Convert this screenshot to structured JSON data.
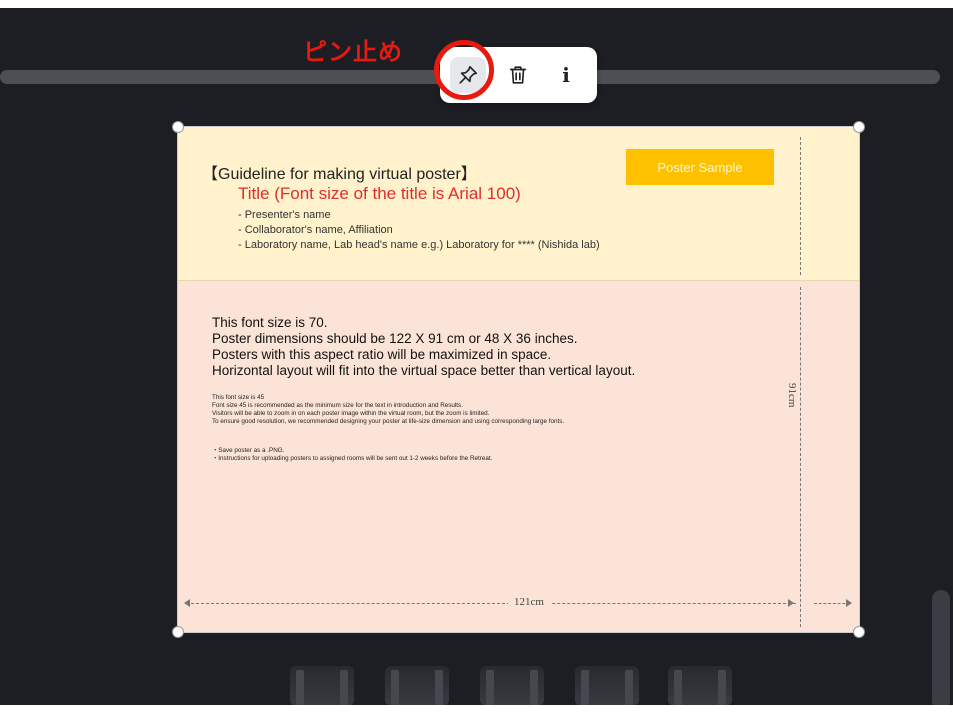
{
  "annotation": {
    "label": "ピン止め",
    "color": "#e8190f"
  },
  "toolbar": {
    "pin_icon": "pin-icon",
    "delete_icon": "trash-icon",
    "info_label": "i"
  },
  "poster": {
    "guideline_title": "【Guideline for making virtual poster】",
    "title_line": "Title (Font size of the title is Arial 100)",
    "header_lines": [
      "- Presenter's name",
      "- Collaborator's name, Affiliation",
      "- Laboratory name, Lab head's name     e.g.) Laboratory for **** (Nishida lab)"
    ],
    "sample_badge": "Poster Sample",
    "body_main": [
      "This font size is 70.",
      "Poster dimensions should be 122 X 91 cm or 48 X 36 inches.",
      "Posters with this aspect ratio will be maximized in space.",
      "Horizontal layout will fit into the virtual space better than vertical layout."
    ],
    "body_small": [
      "This font size is 45",
      "Font size 45 is recommended as the minimum size for the text in introduction and Results.",
      "Visitors will be able to zoom in on each poster image within the virtual room, but the zoom is limited.",
      "To ensure good resolution, we recommended designing your poster at life-size dimension and using corresponding large fonts."
    ],
    "notes": [
      "・Save poster as a .PNG.",
      "・Instructions for uploading posters to assigned rooms will be sent out 1-2 weeks before the Retreat."
    ],
    "width_label": "121cm",
    "height_label": "91cm"
  },
  "colors": {
    "background": "#1c1e23",
    "poster_header": "#fff2cc",
    "poster_body": "#fbe4d7",
    "badge": "#ffc000",
    "title_red": "#e22d2d"
  }
}
